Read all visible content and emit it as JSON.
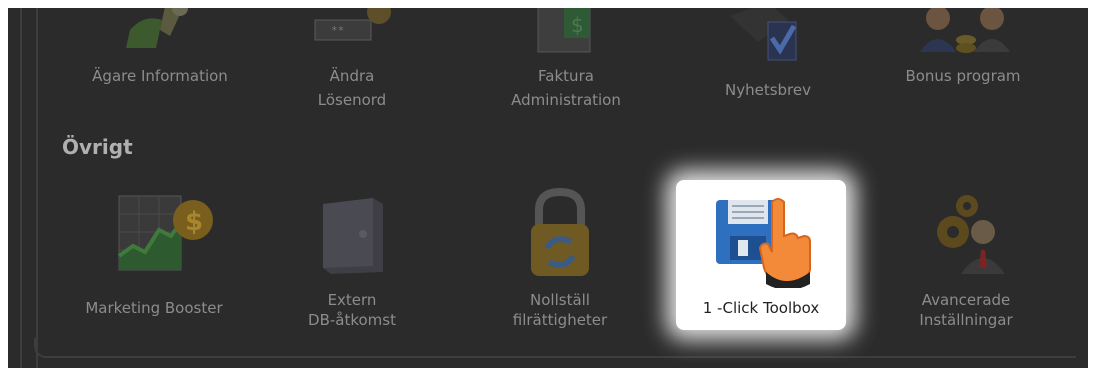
{
  "sections": {
    "top_items": [
      {
        "label_lines": [
          "Ägare Information"
        ]
      },
      {
        "label_lines": [
          "Ändra",
          "Lösenord"
        ]
      },
      {
        "label_lines": [
          "Faktura",
          "Administration"
        ]
      },
      {
        "label_lines": [
          "Nyhetsbrev"
        ]
      },
      {
        "label_lines": [
          "Bonus program"
        ]
      }
    ],
    "ovrigt": {
      "title": "Övrigt",
      "items": [
        {
          "label_lines": [
            "Marketing Booster"
          ],
          "icon": "chart-dollar-icon"
        },
        {
          "label_lines": [
            "Extern",
            "DB-åtkomst"
          ],
          "icon": "server-icon"
        },
        {
          "label_lines": [
            "Nollställ",
            "filrättigheter"
          ],
          "icon": "padlock-refresh-icon"
        },
        {
          "label_lines": [
            "1 -Click Toolbox"
          ],
          "icon": "floppy-pointer-hand-icon",
          "highlighted": true
        },
        {
          "label_lines": [
            "Avancerade",
            "Inställningar"
          ],
          "icon": "gears-user-icon"
        }
      ]
    }
  },
  "colors": {
    "overlay_background": "#2b2b2b",
    "muted_text": "#8c8c8c",
    "heading_text": "#b0b0b0",
    "highlight_background": "#ffffff"
  }
}
